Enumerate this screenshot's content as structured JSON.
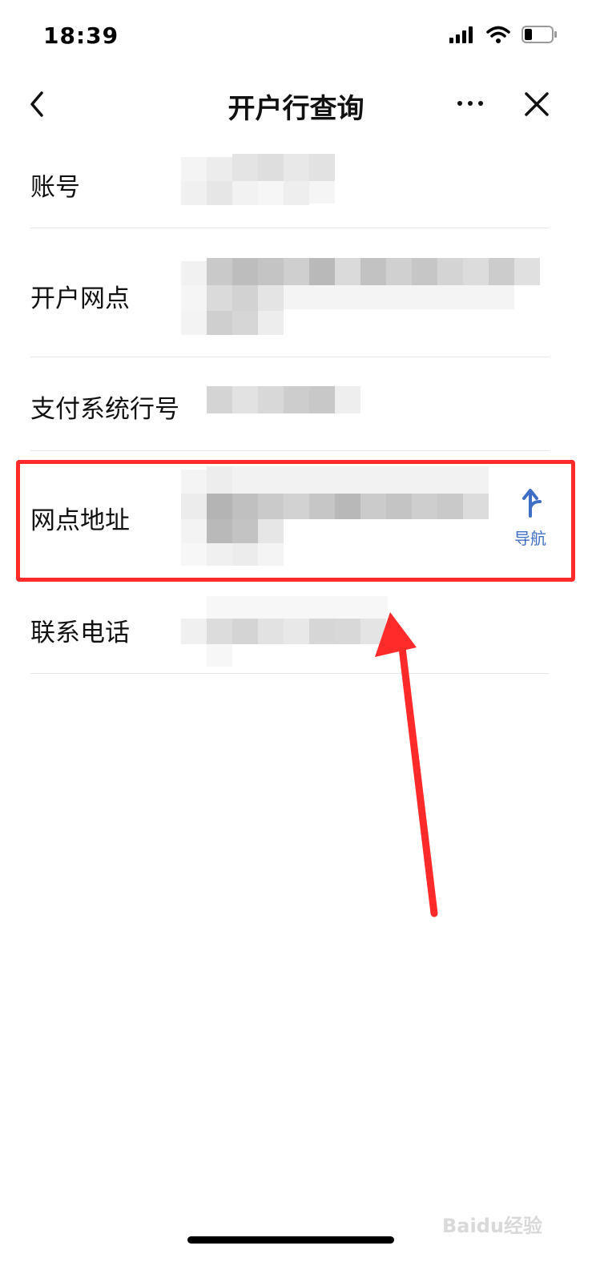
{
  "status_bar": {
    "time": "18:39"
  },
  "nav": {
    "title": "开户行查询"
  },
  "rows": [
    {
      "label": "账号"
    },
    {
      "label": "开户网点"
    },
    {
      "label": "支付系统行号"
    },
    {
      "label": "网点地址"
    },
    {
      "label": "联系电话"
    }
  ],
  "navigate_button": {
    "label": "导航",
    "color": "#3f6fc4"
  },
  "annotation": {
    "box_color": "#ff2a2a",
    "arrow_color": "#ff2a2a"
  },
  "watermark": {
    "text": "Baidu经验"
  }
}
